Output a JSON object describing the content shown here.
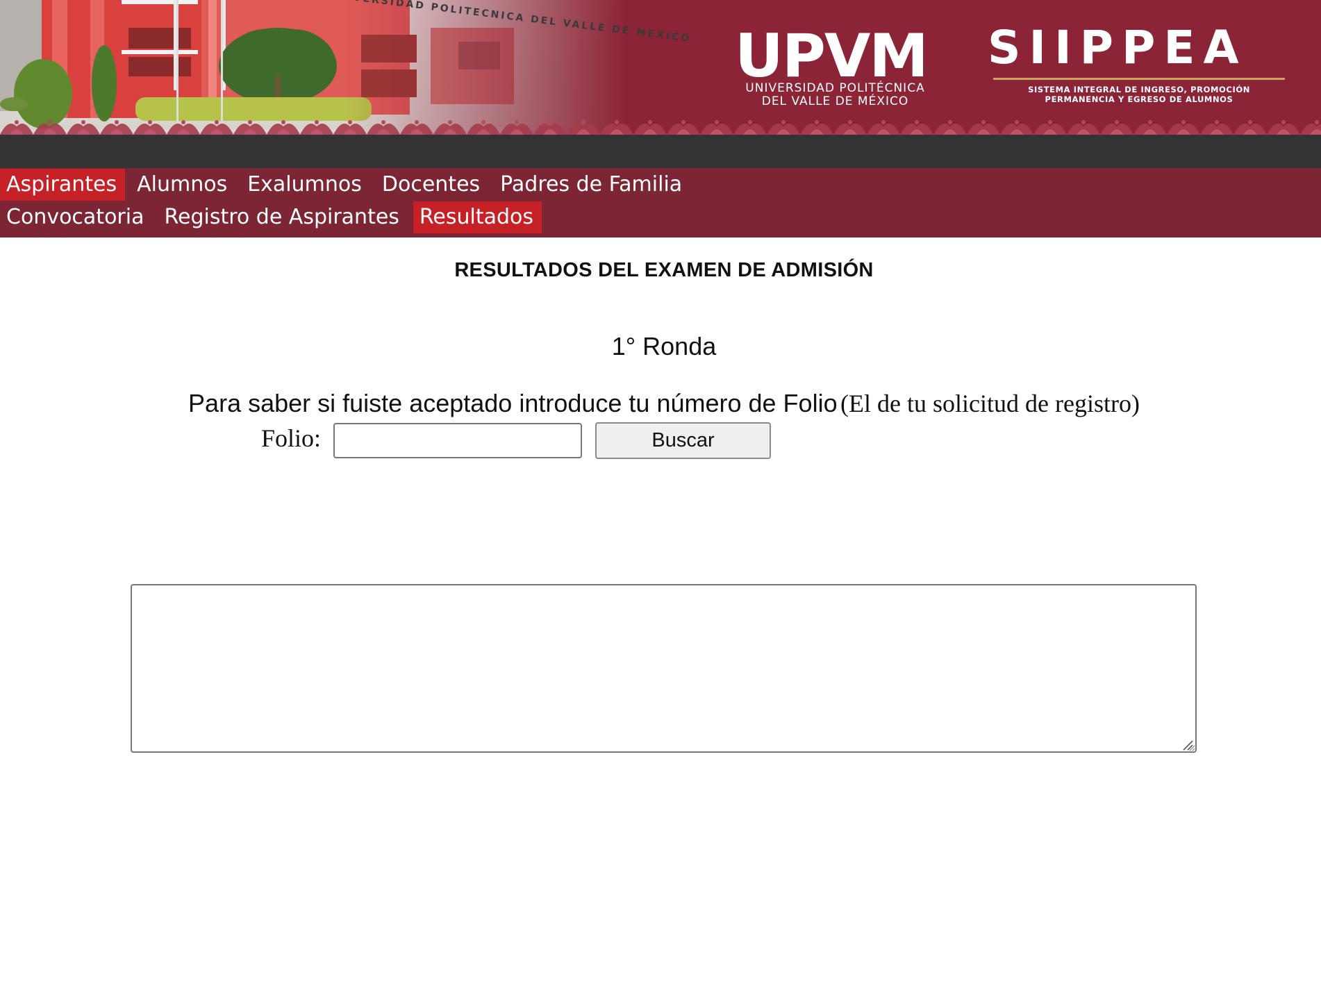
{
  "banner": {
    "building_sign": "UNIVERSIDAD POLITECNICA DEL VALLE DE MEXICO",
    "upvm_logo": {
      "mark": "UPVM",
      "name_line1": "UNIVERSIDAD POLITÉCNICA",
      "name_line2": "DEL VALLE DE MÉXICO"
    },
    "siippea_logo": {
      "mark": "SIIPPEA",
      "subtitle_line1": "SISTEMA INTEGRAL DE INGRESO, PROMOCIÓN",
      "subtitle_line2": "PERMANENCIA Y EGRESO DE ALUMNOS"
    }
  },
  "main_menu": [
    {
      "label": "Aspirantes",
      "active": true
    },
    {
      "label": "Alumnos",
      "active": false
    },
    {
      "label": "Exalumnos",
      "active": false
    },
    {
      "label": "Docentes",
      "active": false
    },
    {
      "label": "Padres de Familia",
      "active": false
    }
  ],
  "sub_menu": [
    {
      "label": "Convocatoria",
      "active": false
    },
    {
      "label": "Registro de Aspirantes",
      "active": false
    },
    {
      "label": "Resultados",
      "active": true
    }
  ],
  "content": {
    "title": "RESULTADOS DEL EXAMEN DE ADMISIÓN",
    "round": "1° Ronda",
    "instruction_main": "Para saber si fuiste aceptado introduce tu número de Folio",
    "instruction_note": "(El de tu solicitud de registro)",
    "folio_label": "Folio:",
    "folio_value": "",
    "search_button": "Buscar",
    "results_text": ""
  },
  "colors": {
    "brand_maroon": "#8c2437",
    "menu_bar": "#7c2535",
    "menu_active": "#c62127",
    "dark_bar": "#333333"
  }
}
